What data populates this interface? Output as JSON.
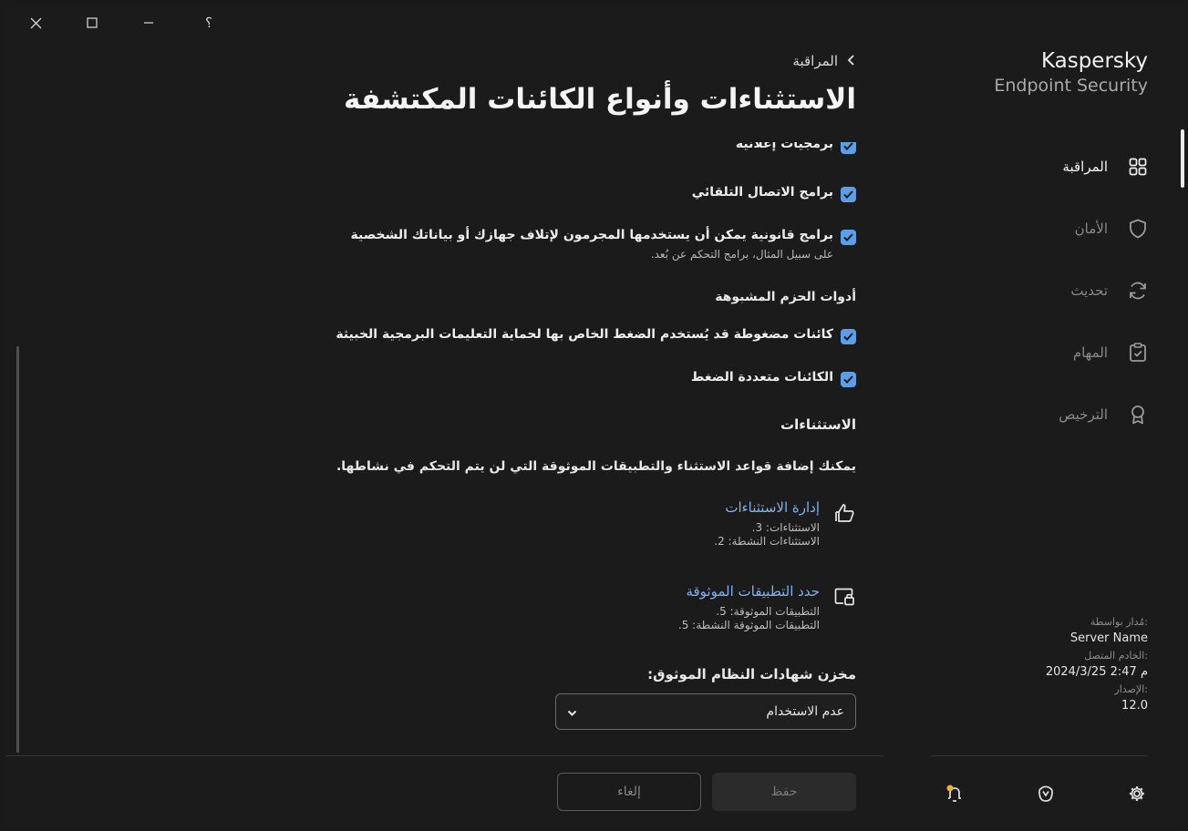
{
  "window": {
    "close_icon": "close-icon",
    "maximize_icon": "maximize-icon",
    "minimize_icon": "minimize-icon",
    "help_glyph": "؟"
  },
  "brand": {
    "name": "Kaspersky",
    "product": "Endpoint Security"
  },
  "nav": {
    "items": [
      {
        "label": "المراقبة",
        "icon": "dashboard-icon",
        "active": true
      },
      {
        "label": "الأمان",
        "icon": "shield-icon",
        "active": false
      },
      {
        "label": "تحديث",
        "icon": "refresh-icon",
        "active": false
      },
      {
        "label": "المهام",
        "icon": "tasks-icon",
        "active": false
      },
      {
        "label": "الترخيص",
        "icon": "license-icon",
        "active": false
      }
    ]
  },
  "info": {
    "managed_by_label": "مُدار بواسطة:",
    "managed_by_value": "Server Name",
    "connected_server_label": "الخادم المتصل:",
    "connected_server_value": "2024/3/25 2:47 م",
    "version_label": "الإصدار:",
    "version_value": "12.0"
  },
  "breadcrumb": {
    "label": "المراقبة"
  },
  "page": {
    "title": "الاستثناءات وأنواع الكائنات المكتشفة"
  },
  "checkboxes": {
    "adware": "برمجيات إعلانية",
    "autodialers": "برامج الاتصال التلقائي",
    "legit_apps": "برامج قانونية يمكن أن يستخدمها المجرمون لإتلاف جهازك أو بياناتك الشخصية",
    "legit_apps_sub": "على سبيل المثال، برامج التحكم عن بُعد.",
    "packed_header": "أدوات الحزم المشبوهة",
    "packed_objects": "كائنات مضغوطة قد يُستخدم الضغط الخاص بها لحماية التعليمات البرمجية الخبيثة",
    "multipacked": "الكائنات متعددة الضغط"
  },
  "exclusions": {
    "header": "الاستثناءات",
    "description": "يمكنك إضافة قواعد الاستثناء والتطبيقات الموثوقة التي لن يتم التحكم في نشاطها.",
    "manage_link": "إدارة الاستثناءات",
    "manage_count": "الاستثناءات: 3.",
    "manage_active": "الاستثناءات النشطة: 2.",
    "trusted_link": "حدد التطبيقات الموثوقة",
    "trusted_count": "التطبيقات الموثوقة: 5.",
    "trusted_active": "التطبيقات الموثوقة النشطة: 5."
  },
  "cert_store": {
    "label": "مخزن شهادات النظام الموثوق:",
    "selected": "عدم الاستخدام"
  },
  "buttons": {
    "save": "حفظ",
    "cancel": "إلغاء"
  },
  "colors": {
    "accent": "#5d9ee8",
    "link": "#7fb2f0",
    "background": "#1b1b1b",
    "notification_dot": "#e8b23a"
  }
}
